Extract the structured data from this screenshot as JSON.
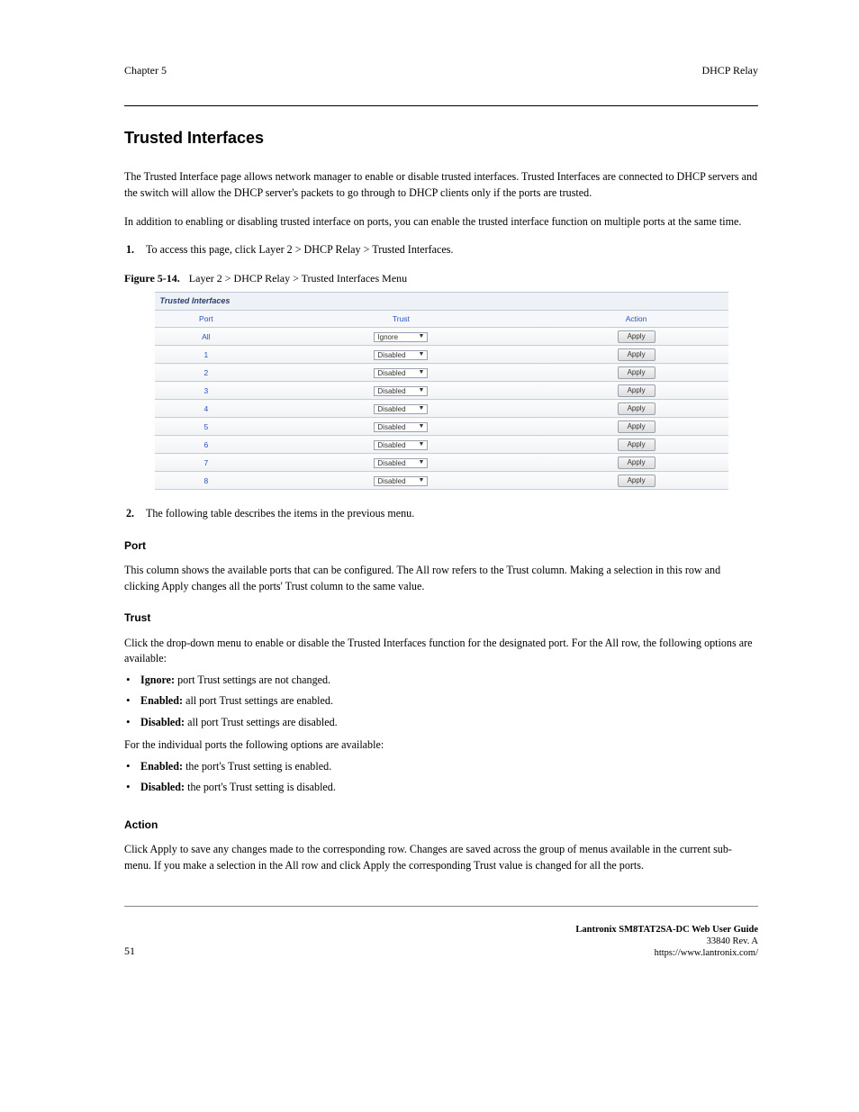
{
  "chapter": {
    "left": "Chapter 5",
    "right": "DHCP Relay"
  },
  "h1": "Trusted Interfaces",
  "intro": [
    "The Trusted Interface page allows network manager to enable or disable trusted interfaces. Trusted Interfaces are connected to DHCP servers and the switch will allow the DHCP server's packets to go through to DHCP clients only if the ports are trusted.",
    "In addition to enabling or disabling trusted interface on ports, you can enable the trusted interface function on multiple ports at the same time.",
    "To access this page, click Layer 2 > DHCP Relay > Trusted Interfaces."
  ],
  "figure": {
    "num": "Figure 5-14.",
    "caption": "Layer 2 > DHCP Relay > Trusted Interfaces Menu"
  },
  "table": {
    "title": "Trusted Interfaces",
    "headers": {
      "port": "Port",
      "trust": "Trust",
      "action": "Action"
    },
    "all_label": "All",
    "all_trust": "Ignore",
    "apply_label": "Apply",
    "rows": [
      {
        "port": "1",
        "trust": "Disabled"
      },
      {
        "port": "2",
        "trust": "Disabled"
      },
      {
        "port": "3",
        "trust": "Disabled"
      },
      {
        "port": "4",
        "trust": "Disabled"
      },
      {
        "port": "5",
        "trust": "Disabled"
      },
      {
        "port": "6",
        "trust": "Disabled"
      },
      {
        "port": "7",
        "trust": "Disabled"
      },
      {
        "port": "8",
        "trust": "Disabled"
      }
    ]
  },
  "items_heading": "The following table describes the items in the previous menu.",
  "fields": {
    "port": {
      "label": "Port",
      "desc": "This column shows the available ports that can be configured. The All row refers to the Trust column. Making a selection in this row and clicking Apply changes all the ports' Trust column to the same value."
    },
    "trust": {
      "label": "Trust",
      "desc": "Click the drop-down menu to enable or disable the Trusted Interfaces function for the designated port. For the All row, the following options are available:",
      "options": [
        {
          "name": "Ignore",
          "text": "port Trust settings are not changed."
        },
        {
          "name": "Enabled",
          "text": "all port Trust settings are enabled."
        },
        {
          "name": "Disabled",
          "text": "all port Trust settings are disabled."
        }
      ],
      "tail": "For the individual ports the following options are available:",
      "options2": [
        {
          "name": "Enabled",
          "text": "the port's Trust setting is enabled."
        },
        {
          "name": "Disabled",
          "text": "the port's Trust setting is disabled."
        }
      ]
    },
    "action": {
      "label": "Action",
      "desc": "Click Apply to save any changes made to the corresponding row. Changes are saved across the group of menus available in the current sub-menu. If you make a selection in the All row and click Apply the corresponding Trust value is changed for all the ports."
    }
  },
  "footer": {
    "page": "51",
    "t1": "Lantronix SM8TAT2SA-DC Web User Guide",
    "t2": "33840 Rev. A",
    "url": "https://www.lantronix.com/"
  }
}
